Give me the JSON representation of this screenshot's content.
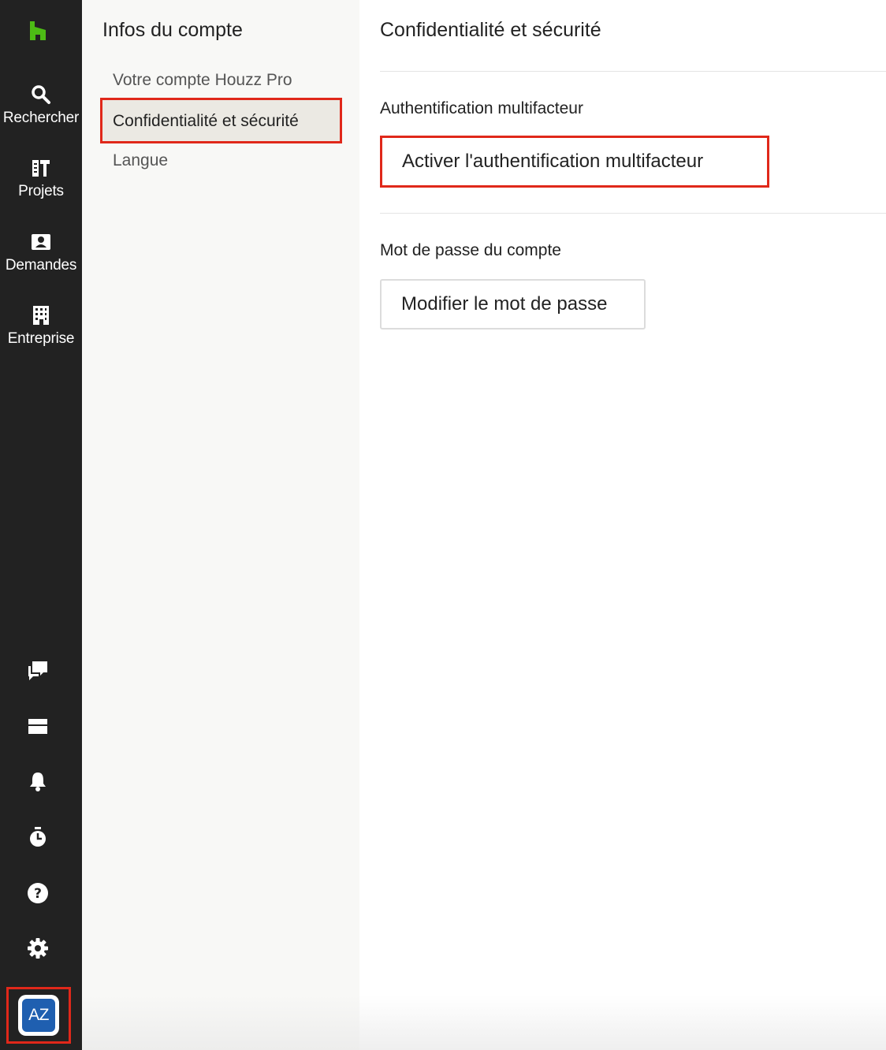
{
  "rail": {
    "items": [
      {
        "label": "Rechercher",
        "icon": "search-icon"
      },
      {
        "label": "Projets",
        "icon": "projects-icon"
      },
      {
        "label": "Demandes",
        "icon": "requests-icon"
      },
      {
        "label": "Entreprise",
        "icon": "business-icon"
      }
    ],
    "utility_icons": [
      "chat-icon",
      "inbox-icon",
      "bell-icon",
      "timer-icon",
      "help-icon",
      "gear-icon"
    ],
    "avatar_initials": "AZ",
    "brand_color": "#4dbc15"
  },
  "subnav": {
    "title": "Infos du compte",
    "items": [
      {
        "label": "Votre compte Houzz Pro"
      },
      {
        "label": "Confidentialité et sécurité",
        "active": true
      },
      {
        "label": "Langue"
      }
    ]
  },
  "main": {
    "title": "Confidentialité et sécurité",
    "mfa": {
      "heading": "Authentification multifacteur",
      "button_label": "Activer l'authentification multifacteur"
    },
    "password": {
      "heading": "Mot de passe du compte",
      "button_label": "Modifier le mot de passe"
    }
  },
  "highlight_color": "#e0281a"
}
